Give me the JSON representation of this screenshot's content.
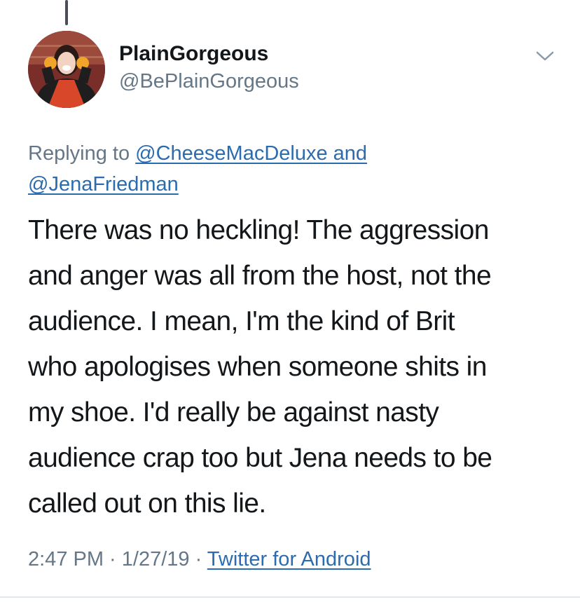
{
  "author": {
    "display_name": "PlainGorgeous",
    "handle": "@BePlainGorgeous"
  },
  "reply": {
    "prefix": "Replying to ",
    "mention_1": "@CheeseMacDeluxe",
    "joiner": " and",
    "mention_2": "@JenaFriedman"
  },
  "tweet": {
    "lines": [
      "There was no heckling! The aggression",
      "and anger was all from the host, not the",
      "audience. I mean, I'm the kind of Brit",
      "who apologises when someone shits in",
      "my shoe. I'd really be against nasty",
      "audience crap too but Jena needs to be",
      "called out on this lie."
    ]
  },
  "meta": {
    "time": "2:47 PM",
    "separator": " · ",
    "date": "1/27/19",
    "source": "Twitter for Android"
  },
  "icons": {
    "menu": "chevron-down-icon",
    "avatar": "avatar"
  },
  "colors": {
    "link": "#2b6cb0",
    "muted": "#657786",
    "text": "#14171a"
  }
}
